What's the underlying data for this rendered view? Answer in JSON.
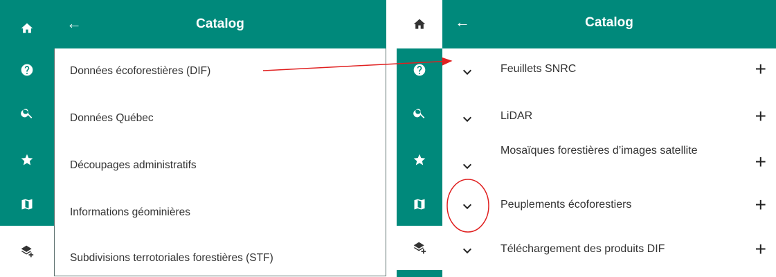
{
  "colors": {
    "teal": "#00897b",
    "annotation": "#e02020"
  },
  "left_panel": {
    "title": "Catalog",
    "rail_icons": [
      "home-icon",
      "help-icon",
      "search-icon",
      "star-icon",
      "map-icon",
      "layers-add-icon"
    ],
    "items": [
      {
        "label": "Données écoforestières (DIF)"
      },
      {
        "label": "Données Québec"
      },
      {
        "label": "Découpages administratifs"
      },
      {
        "label": "Informations géominières"
      },
      {
        "label": "Subdivisions terrotoriales forestières (STF)"
      }
    ]
  },
  "right_panel": {
    "title": "Catalog",
    "items": [
      {
        "label": "Feuillets SNRC"
      },
      {
        "label": "LiDAR"
      },
      {
        "label": "Mosaïques forestières d’images satellite"
      },
      {
        "label": "Peuplements écoforestiers"
      },
      {
        "label": "Téléchargement des produits DIF"
      }
    ],
    "plus_symbol": "+"
  }
}
